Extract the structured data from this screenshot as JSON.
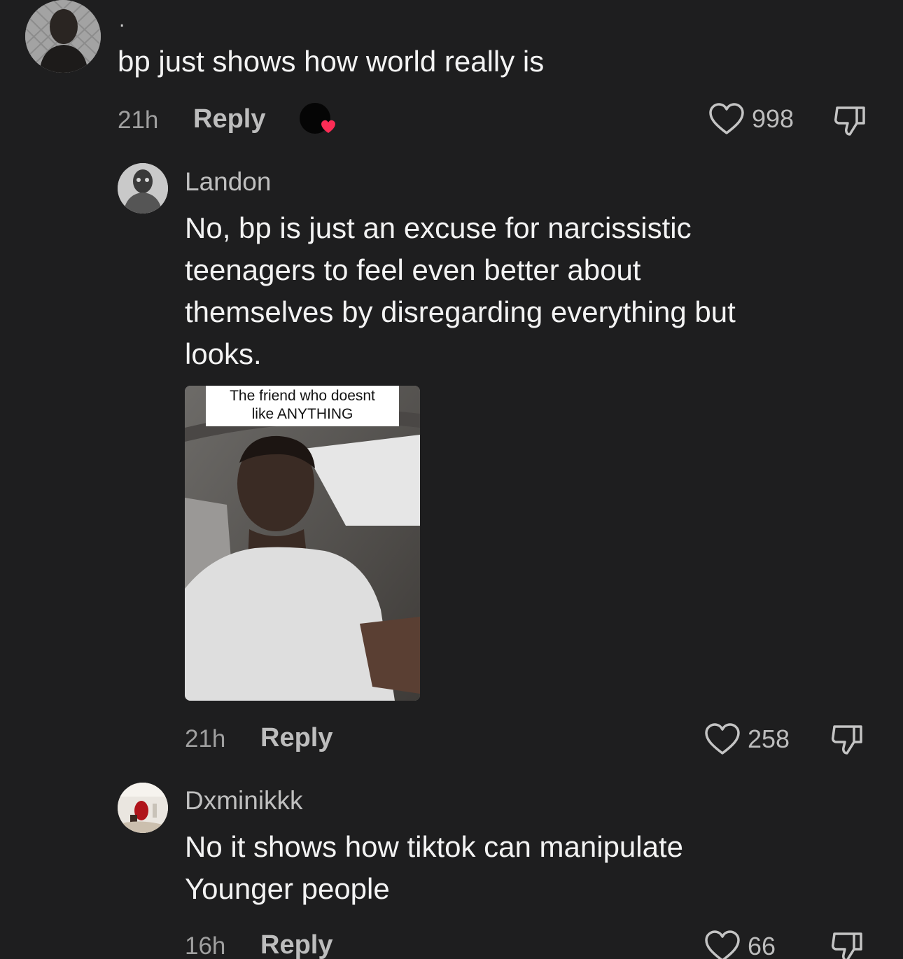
{
  "comments": [
    {
      "username": ".",
      "text": "bp just shows how world really is",
      "time": "21h",
      "reply_label": "Reply",
      "likes": "998"
    },
    {
      "username": "Landon",
      "text": "No, bp is just an excuse for narcissistic\nteenagers to feel even better about\nthemselves by disregarding everything but\nlooks.",
      "gif_caption": "The friend who doesnt\nlike ANYTHING",
      "time": "21h",
      "reply_label": "Reply",
      "likes": "258"
    },
    {
      "username": "Dxminikkk",
      "text": "No it shows how tiktok can manipulate\nYounger people",
      "time": "16h",
      "reply_label": "Reply",
      "likes": "66"
    }
  ],
  "icons": {
    "like": "heart-outline-icon",
    "dislike": "thumbs-down-icon",
    "creator_liked": "creator-liked-heart-icon"
  },
  "colors": {
    "background": "#1e1e1f",
    "creator_heart": "#fe2c55"
  }
}
